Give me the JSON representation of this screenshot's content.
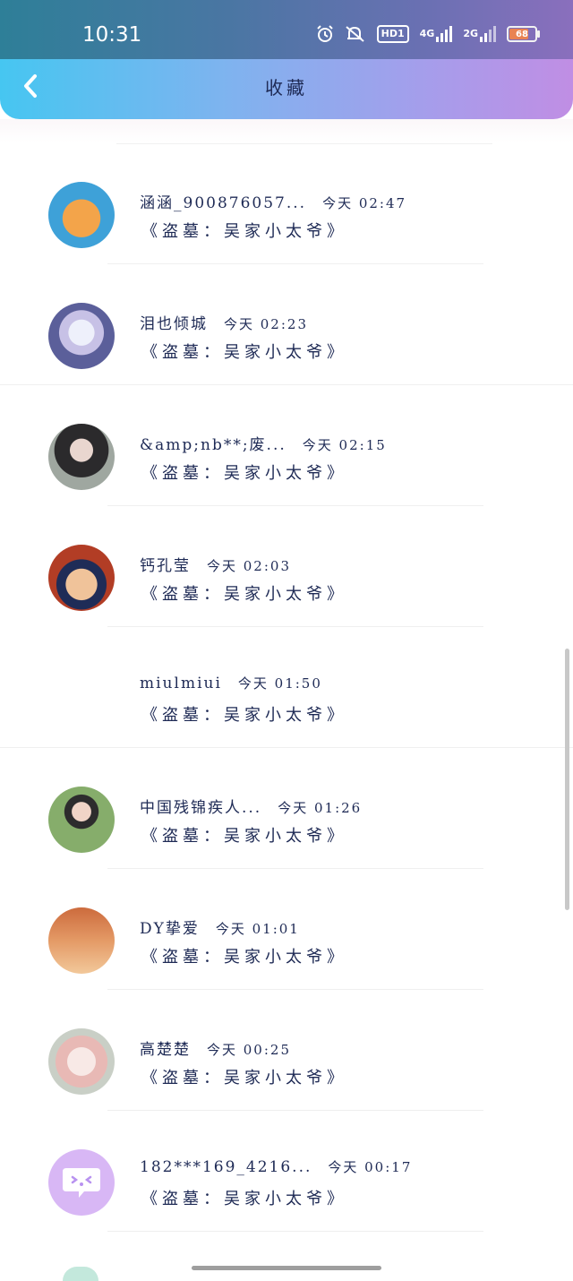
{
  "status_bar": {
    "time": "10:31",
    "hd_label": "HD1",
    "net_4g": "4G",
    "net_2g": "2G",
    "battery": "68",
    "icons": [
      "alarm-icon",
      "mute-icon",
      "hd-icon",
      "signal-4g-icon",
      "signal-2g-icon",
      "battery-icon"
    ]
  },
  "header": {
    "title": "收藏",
    "back_icon": "chevron-left-icon"
  },
  "items": [
    {
      "name": "涵涵_900876057...",
      "time": "今天 02:47",
      "subtitle": "《盗墓：吴家小太爷》"
    },
    {
      "name": "泪也倾城",
      "time": "今天 02:23",
      "subtitle": "《盗墓：吴家小太爷》"
    },
    {
      "name": "&amp;nb**;废...",
      "time": "今天 02:15",
      "subtitle": "《盗墓：吴家小太爷》"
    },
    {
      "name": "钙孔莹",
      "time": "今天 02:03",
      "subtitle": "《盗墓：吴家小太爷》"
    },
    {
      "name": "miulmiui",
      "time": "今天 01:50",
      "subtitle": "《盗墓：吴家小太爷》"
    },
    {
      "name": "中国残锦疾人...",
      "time": "今天 01:26",
      "subtitle": "《盗墓：吴家小太爷》"
    },
    {
      "name": "DY挚爱",
      "time": "今天 01:01",
      "subtitle": "《盗墓：吴家小太爷》"
    },
    {
      "name": "高楚楚",
      "time": "今天 00:25",
      "subtitle": "《盗墓：吴家小太爷》"
    },
    {
      "name": "182***169_4216...",
      "time": "今天 00:17",
      "subtitle": "《盗墓：吴家小太爷》"
    }
  ],
  "colors": {
    "header_start": "#46c6f1",
    "header_end": "#c08ee4",
    "text": "#1e2a55"
  }
}
